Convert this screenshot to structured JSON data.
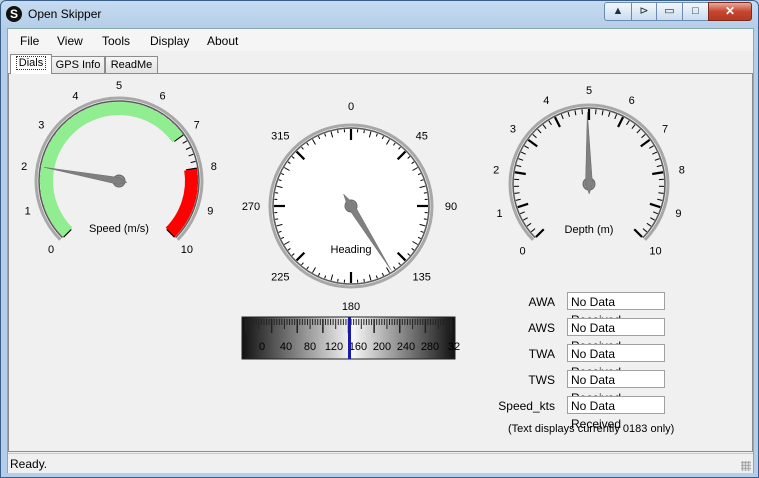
{
  "window": {
    "title": "Open Skipper",
    "app_icon": "S"
  },
  "caption": {
    "up": "▲",
    "pin": "⊳",
    "min": "▭",
    "max": "□",
    "close": "✕"
  },
  "menu": [
    {
      "label": "File"
    },
    {
      "label": "View"
    },
    {
      "label": "Tools"
    },
    {
      "label": "Display"
    },
    {
      "label": "About"
    }
  ],
  "tabs": [
    {
      "label": "Dials"
    },
    {
      "label": "GPS Info"
    },
    {
      "label": "ReadMe"
    }
  ],
  "gauges": {
    "speed": {
      "label": "Speed (m/s)",
      "ticks": [
        "0",
        "1",
        "2",
        "3",
        "4",
        "5",
        "6",
        "7",
        "8",
        "9",
        "10"
      ],
      "value": 2.05
    },
    "heading": {
      "label": "Heading",
      "ticks": [
        "0",
        "45",
        "90",
        "135",
        "180",
        "225",
        "270",
        "315"
      ],
      "value": 148
    },
    "depth": {
      "label": "Depth (m)",
      "ticks": [
        "0",
        "1",
        "2",
        "3",
        "4",
        "5",
        "6",
        "7",
        "8",
        "9",
        "10"
      ],
      "value": 4.95
    }
  },
  "compass_strip": {
    "labels": [
      "0",
      "40",
      "80",
      "120",
      "160",
      "200",
      "240",
      "280",
      "32"
    ]
  },
  "wind_fields": [
    {
      "label": "AWA",
      "value": "No Data Received"
    },
    {
      "label": "AWS",
      "value": "No Data Received"
    },
    {
      "label": "TWA",
      "value": "No Data Received"
    },
    {
      "label": "TWS",
      "value": "No Data Received"
    },
    {
      "label": "Speed_kts",
      "value": "No Data Received"
    }
  ],
  "note": "(Text displays currently 0183 only)",
  "status": "Ready.",
  "colors": {
    "green_band": "#90ee90",
    "red_band": "#ff0000",
    "needle": "#808080"
  }
}
